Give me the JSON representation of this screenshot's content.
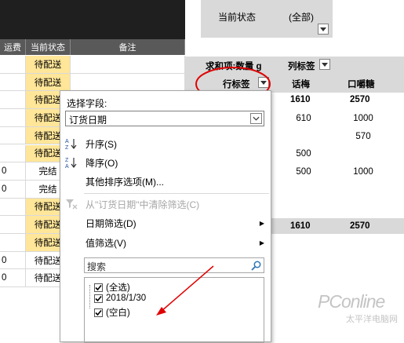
{
  "left_table": {
    "headers": [
      "运费",
      "当前状态",
      "备注"
    ],
    "rows": [
      {
        "fee": "",
        "status": "待配送",
        "hl": true
      },
      {
        "fee": "",
        "status": "待配送",
        "hl": true
      },
      {
        "fee": "",
        "status": "待配送",
        "hl": true
      },
      {
        "fee": "",
        "status": "待配送",
        "hl": true
      },
      {
        "fee": "",
        "status": "待配送",
        "hl": true
      },
      {
        "fee": "",
        "status": "待配送",
        "hl": true
      },
      {
        "fee": "0",
        "status": "完结",
        "hl": false
      },
      {
        "fee": "0",
        "status": "完结",
        "hl": false
      },
      {
        "fee": "",
        "status": "待配送",
        "hl": true
      },
      {
        "fee": "",
        "status": "待配送",
        "hl": true
      },
      {
        "fee": "",
        "status": "待配送",
        "hl": true
      },
      {
        "fee": "0",
        "status": "待配送",
        "hl": false
      },
      {
        "fee": "0",
        "status": "待配送",
        "hl": false
      }
    ]
  },
  "pivot": {
    "filter_label": "当前状态",
    "filter_value": "(全部)",
    "sum_label": "求和项:数量 g",
    "col_label": "列标签",
    "row_label": "行标签",
    "col_headers": [
      "话梅",
      "口嚼糖"
    ],
    "rows": [
      {
        "a": "1610",
        "b": "2570",
        "bold": true
      },
      {
        "a": "610",
        "b": "1000",
        "bold": false
      },
      {
        "a": "",
        "b": "570",
        "bold": false
      },
      {
        "a": "500",
        "b": "",
        "bold": false
      },
      {
        "a": "500",
        "b": "1000",
        "bold": false
      }
    ],
    "total": {
      "a": "1610",
      "b": "2570"
    }
  },
  "popup": {
    "select_field_label": "选择字段:",
    "field_value": "订货日期",
    "menu": {
      "sort_asc": "升序(S)",
      "sort_desc": "降序(O)",
      "more_sort": "其他排序选项(M)...",
      "clear_filter": "从\"订货日期\"中清除筛选(C)",
      "date_filter": "日期筛选(D)",
      "value_filter": "值筛选(V)"
    },
    "search_placeholder": "搜索",
    "tree": {
      "select_all": "(全选)",
      "item1": "2018/1/30",
      "item2": "(空白)"
    }
  },
  "watermark": {
    "brand": "PConline",
    "sub": "太平洋电脑网"
  },
  "colors": {
    "yellow": "#ffe699",
    "header_dark": "#595959",
    "highlight_red": "#e00000"
  }
}
